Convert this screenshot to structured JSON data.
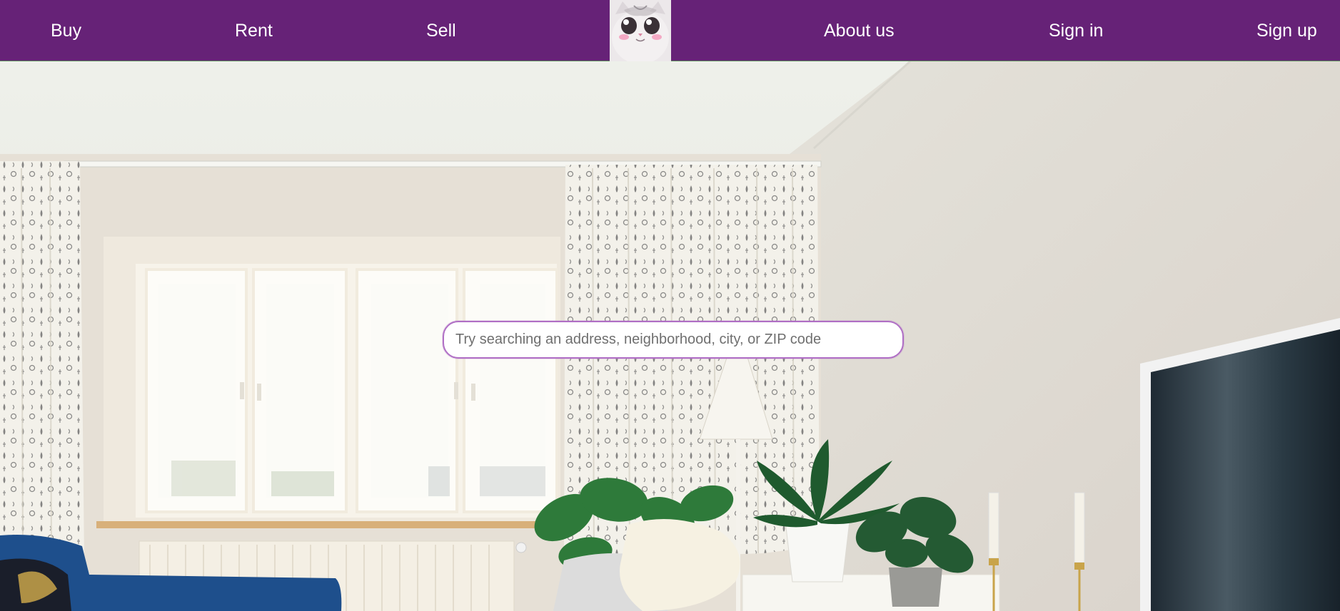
{
  "nav": {
    "buy": "Buy",
    "rent": "Rent",
    "sell": "Sell",
    "about": "About us",
    "sign_in": "Sign in",
    "sign_up": "Sign up",
    "logo_icon": "cat-face-icon"
  },
  "search": {
    "placeholder": "Try searching an address, neighborhood, city, or ZIP code",
    "value": ""
  },
  "colors": {
    "nav_background": "#662277",
    "nav_text": "#ffffff",
    "search_border": "#b06fc5"
  }
}
